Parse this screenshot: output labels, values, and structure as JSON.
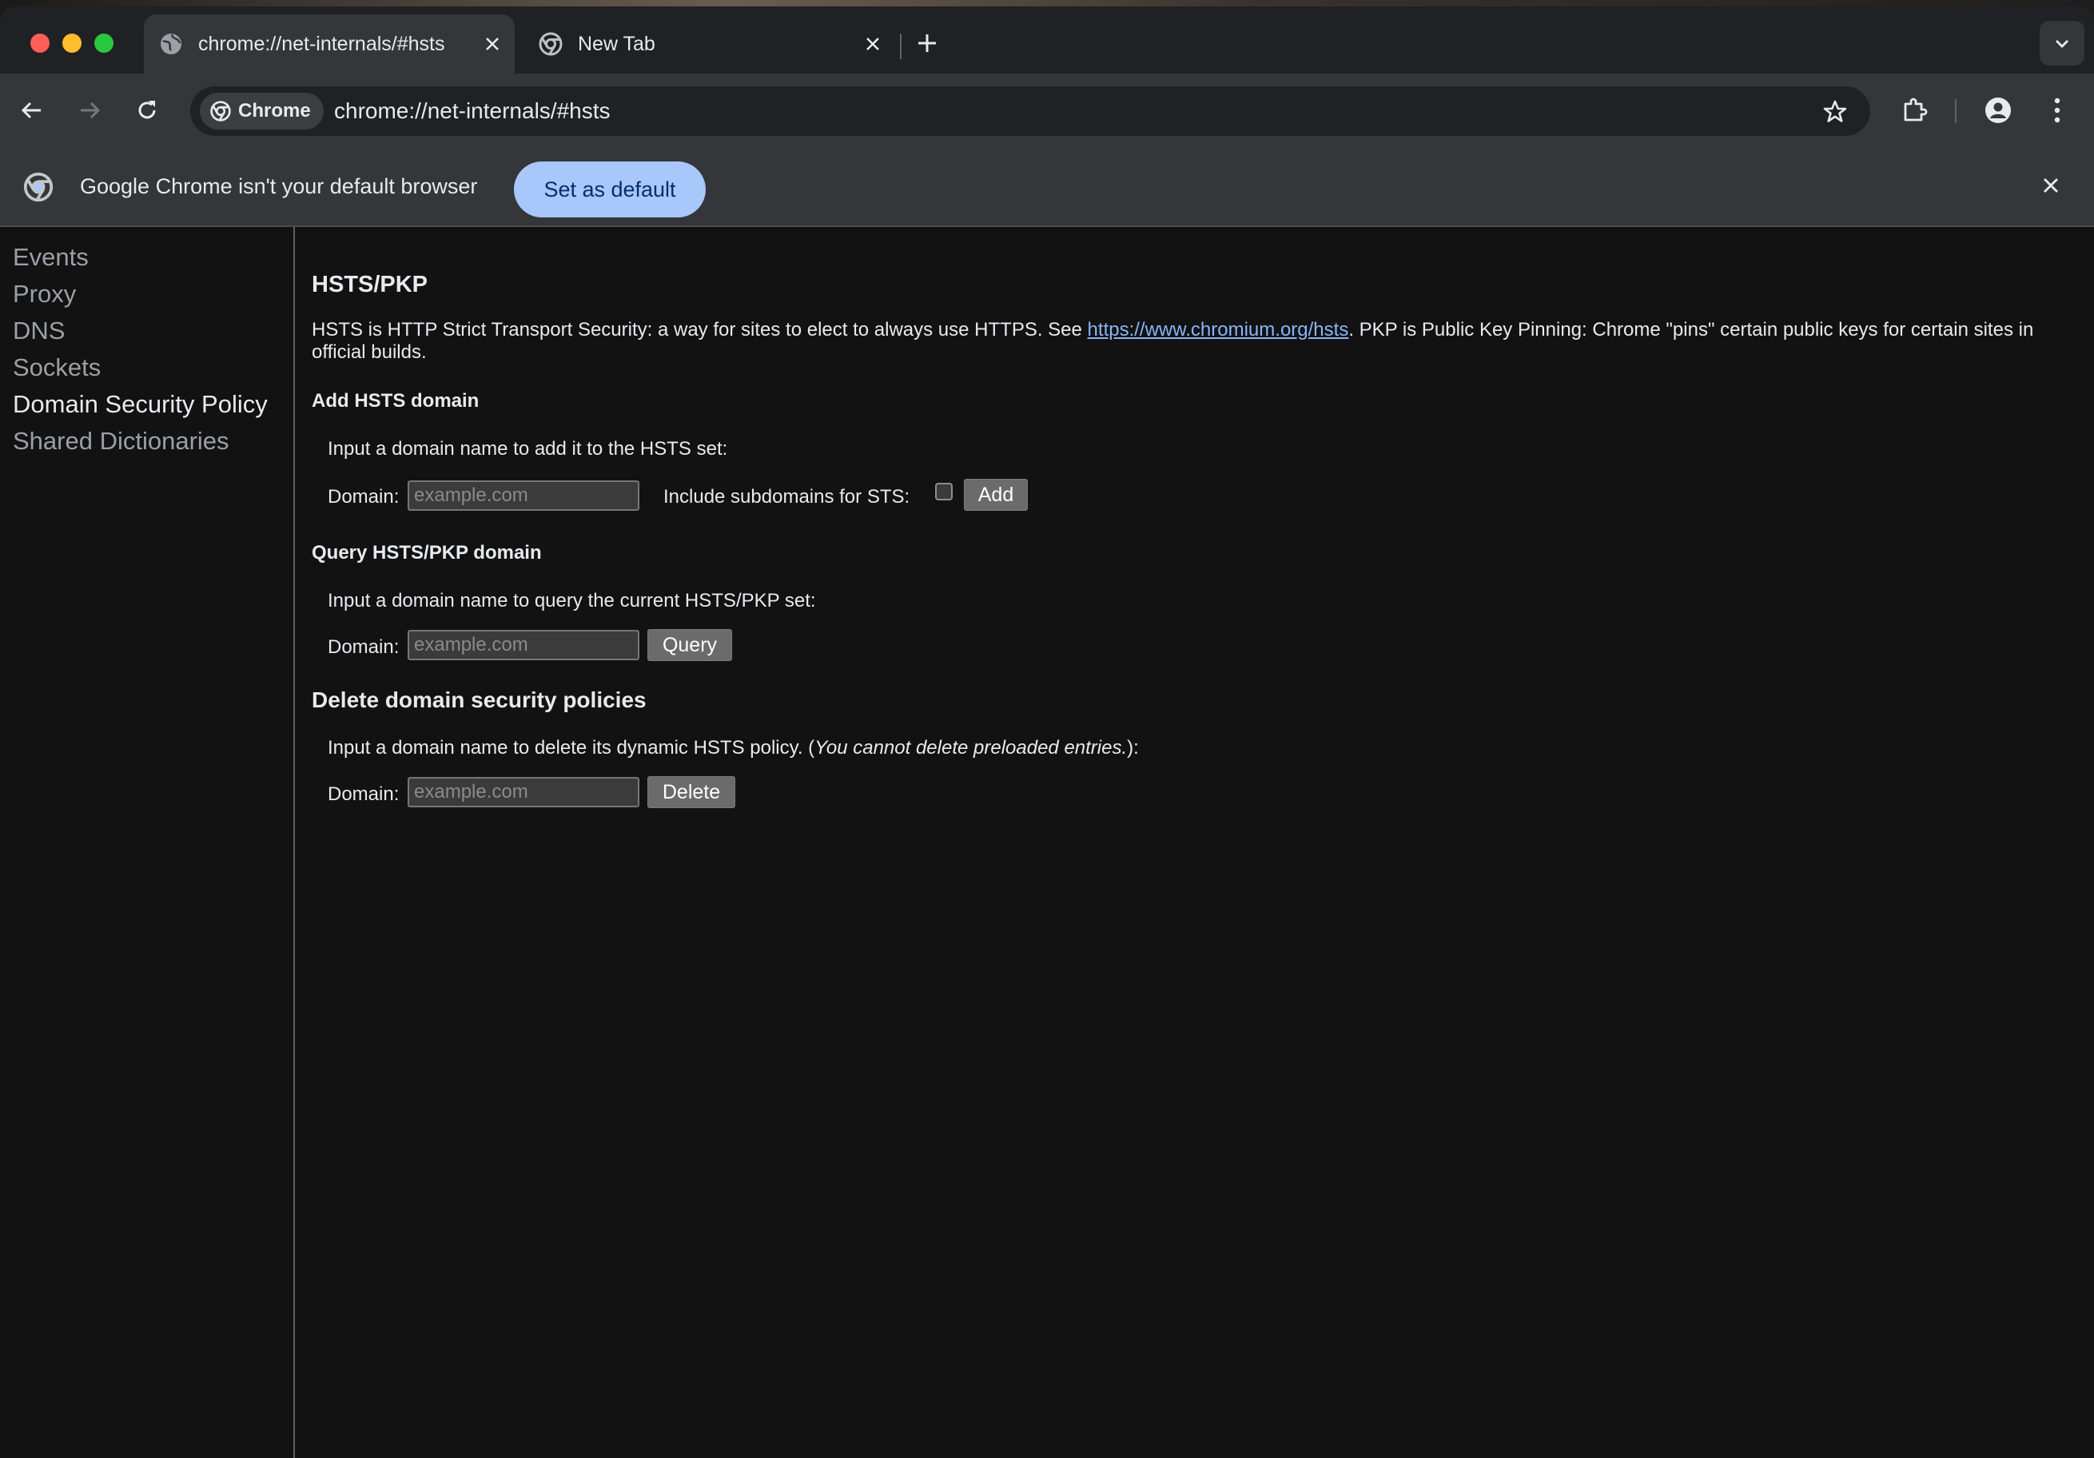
{
  "browser": {
    "tabs": [
      {
        "title": "chrome://net-internals/#hsts",
        "active": true,
        "favicon": "globe-icon"
      },
      {
        "title": "New Tab",
        "active": false,
        "favicon": "chrome-icon"
      }
    ],
    "address": {
      "chip_label": "Chrome",
      "url": "chrome://net-internals/#hsts"
    }
  },
  "infobar": {
    "message": "Google Chrome isn't your default browser",
    "button_label": "Set as default"
  },
  "sidebar": {
    "items": [
      {
        "label": "Events",
        "selected": false
      },
      {
        "label": "Proxy",
        "selected": false
      },
      {
        "label": "DNS",
        "selected": false
      },
      {
        "label": "Sockets",
        "selected": false
      },
      {
        "label": "Domain Security Policy",
        "selected": true
      },
      {
        "label": "Shared Dictionaries",
        "selected": false
      }
    ]
  },
  "main": {
    "title": "HSTS/PKP",
    "description_before_link": "HSTS is HTTP Strict Transport Security: a way for sites to elect to always use HTTPS. See ",
    "link_text": "https://www.chromium.org/hsts",
    "description_after_link": ". PKP is Public Key Pinning: Chrome \"pins\" certain public keys for certain sites in official builds.",
    "add": {
      "heading": "Add HSTS domain",
      "instruction": "Input a domain name to add it to the HSTS set:",
      "domain_label": "Domain:",
      "placeholder": "example.com",
      "subdomains_label": "Include subdomains for STS:",
      "subdomains_checked": false,
      "button_label": "Add"
    },
    "query": {
      "heading": "Query HSTS/PKP domain",
      "instruction": "Input a domain name to query the current HSTS/PKP set:",
      "domain_label": "Domain:",
      "placeholder": "example.com",
      "button_label": "Query"
    },
    "delete": {
      "heading": "Delete domain security policies",
      "instruction_before": "Input a domain name to delete its dynamic HSTS policy. (",
      "instruction_italic": "You cannot delete preloaded entries.",
      "instruction_after": "):",
      "domain_label": "Domain:",
      "placeholder": "example.com",
      "button_label": "Delete"
    }
  },
  "colors": {
    "link": "#8ab4f8",
    "set_default_bg": "#a8c7fa",
    "page_bg": "#121212"
  }
}
